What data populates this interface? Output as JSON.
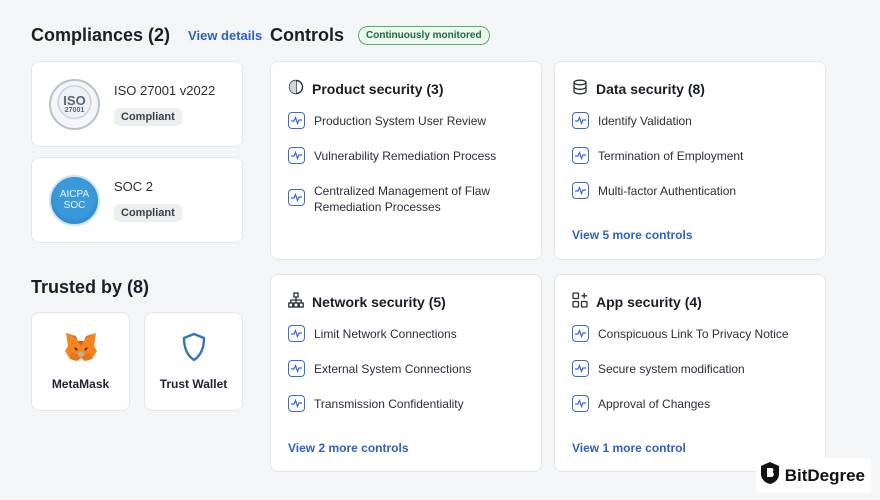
{
  "compliances": {
    "title": "Compliances (2)",
    "view_details": "View details",
    "items": [
      {
        "badge_line1": "ISO",
        "badge_line2": "27001",
        "name": "ISO 27001 v2022",
        "status": "Compliant"
      },
      {
        "badge_line1": "AICPA",
        "badge_line2": "SOC",
        "name": "SOC 2",
        "status": "Compliant"
      }
    ]
  },
  "trusted": {
    "title": "Trusted by (8)",
    "items": [
      {
        "name": "MetaMask",
        "icon": "fox-icon"
      },
      {
        "name": "Trust Wallet",
        "icon": "shield-icon"
      }
    ]
  },
  "controls": {
    "title": "Controls",
    "badge": "Continuously monitored",
    "accent": "#2f5fc4",
    "sections": [
      {
        "title": "Product security (3)",
        "icon": "shield-half-icon",
        "items": [
          "Production System User Review",
          "Vulnerability Remediation Process",
          "Centralized Management of Flaw Remediation Processes"
        ],
        "more": ""
      },
      {
        "title": "Data security (8)",
        "icon": "database-icon",
        "items": [
          "Identify Validation",
          "Termination of Employment",
          "Multi-factor Authentication"
        ],
        "more": "View 5 more controls"
      },
      {
        "title": "Network security (5)",
        "icon": "network-icon",
        "items": [
          "Limit Network Connections",
          "External System Connections",
          "Transmission Confidentiality"
        ],
        "more": "View 2 more controls"
      },
      {
        "title": "App security (4)",
        "icon": "apps-icon",
        "items": [
          "Conspicuous Link To Privacy Notice",
          "Secure system modification",
          "Approval of Changes"
        ],
        "more": "View 1 more control"
      }
    ]
  },
  "watermark": {
    "text": "BitDegree"
  }
}
